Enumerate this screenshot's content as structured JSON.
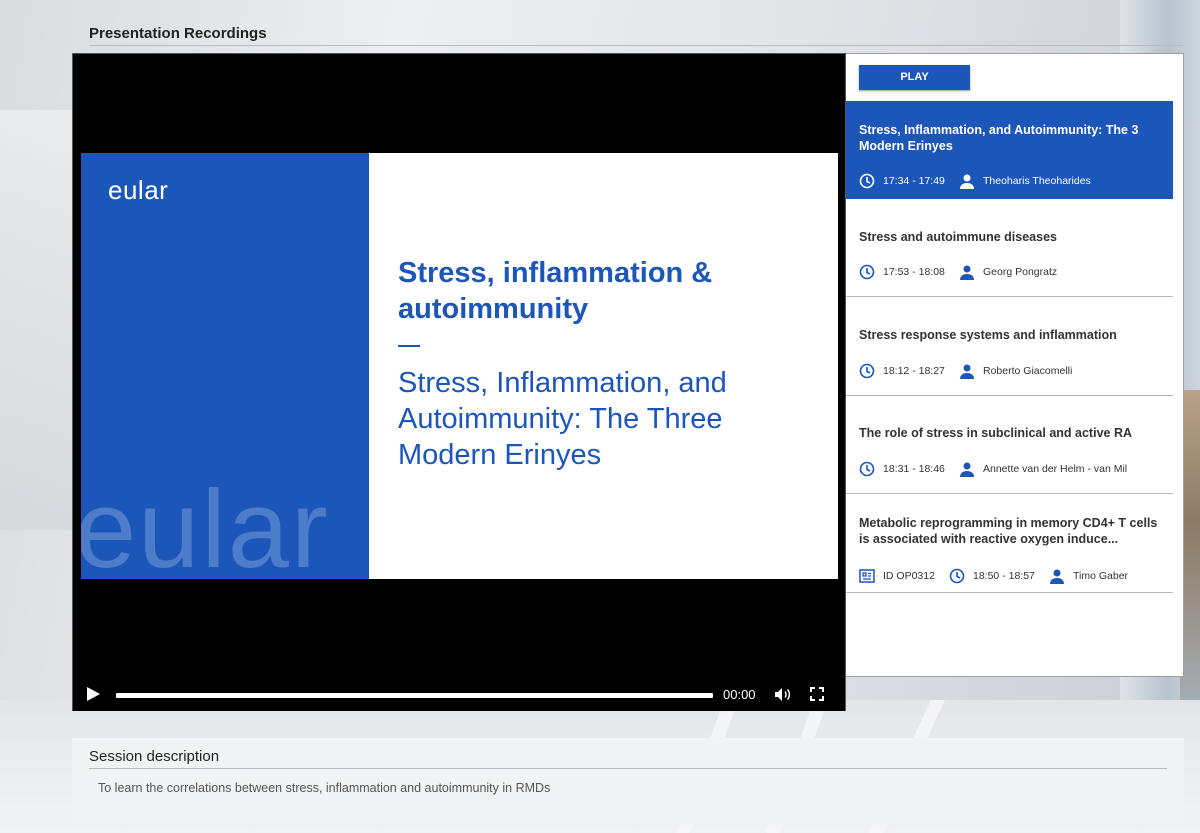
{
  "page": {
    "title": "Presentation Recordings"
  },
  "slide": {
    "logo": "eular",
    "watermark": "eular",
    "heading": "Stress, inflammation & autoimmunity",
    "subtitle": "Stress, Inflammation, and Autoimmunity: The Three Modern Erinyes"
  },
  "player": {
    "time": "00:00",
    "progress": 0
  },
  "playlist": {
    "play_label": "PLAY",
    "items": [
      {
        "title": "Stress, Inflammation, and Autoimmunity: The 3 Modern Erinyes",
        "time": "17:34 - 17:49",
        "speaker": "Theoharis Theoharides",
        "active": true
      },
      {
        "title": "Stress and autoimmune diseases",
        "time": "17:53 - 18:08",
        "speaker": "Georg Pongratz"
      },
      {
        "title": "Stress response systems and inflammation",
        "time": "18:12 - 18:27",
        "speaker": "Roberto Giacomelli"
      },
      {
        "title": "The role of stress in subclinical and active RA",
        "time": "18:31 - 18:46",
        "speaker": "Annette van der Helm - van Mil"
      },
      {
        "title": "Metabolic reprogramming in memory CD4+ T cells is associated with reactive oxygen induce...",
        "id": "ID OP0312",
        "time": "18:50 - 18:57",
        "speaker": "Timo Gaber"
      }
    ]
  },
  "session": {
    "title": "Session description",
    "text": "To learn the correlations between stress, inflammation and autoimmunity in RMDs"
  },
  "colors": {
    "brand": "#1c56b8",
    "watermark": "#4d7ccb"
  },
  "icons": [
    "play-icon",
    "volume-icon",
    "fullscreen-icon",
    "clock-icon",
    "person-icon",
    "document-icon"
  ]
}
